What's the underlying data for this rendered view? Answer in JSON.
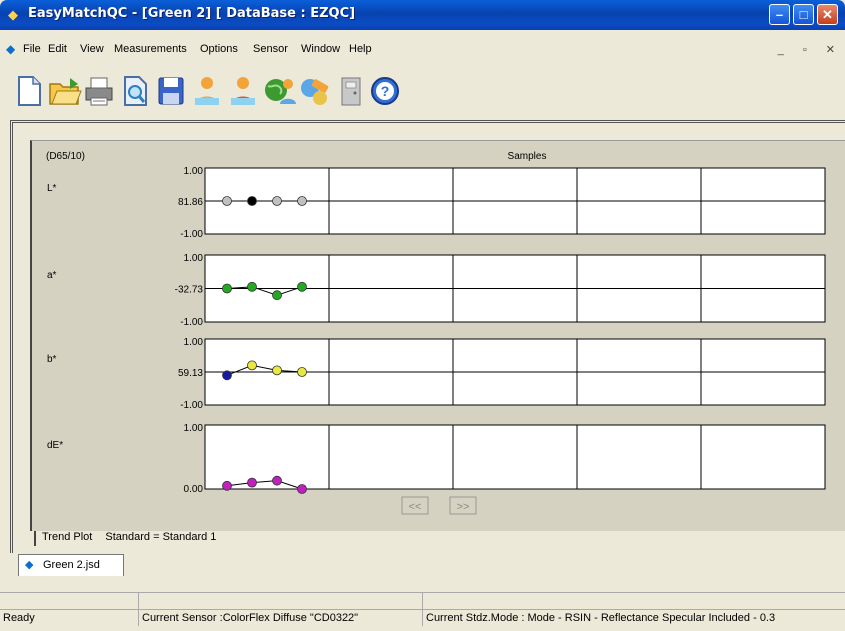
{
  "window": {
    "title": "EasyMatchQC - [Green 2]   [ DataBase : EZQC]"
  },
  "menu": {
    "items": [
      "File",
      "Edit",
      "View",
      "Measurements",
      "Options",
      "Sensor",
      "Window",
      "Help"
    ]
  },
  "toolbar": {
    "icons": [
      "new-document-icon",
      "open-folder-icon",
      "print-icon",
      "print-preview-icon",
      "save-icon",
      "standard-icon",
      "sample-icon",
      "database-icon",
      "sensor-icon",
      "exit-icon",
      "help-icon"
    ]
  },
  "plot": {
    "illuminant": "(D65/10)",
    "header": "Samples",
    "prev_label": "<<",
    "next_label": ">>",
    "charts": [
      {
        "label": "L*",
        "top_tick": "1.00",
        "mid_tick": "81.86",
        "bottom_tick": "-1.00"
      },
      {
        "label": "a*",
        "top_tick": "1.00",
        "mid_tick": "-32.73",
        "bottom_tick": "-1.00"
      },
      {
        "label": "b*",
        "top_tick": "1.00",
        "mid_tick": "59.13",
        "bottom_tick": "-1.00"
      },
      {
        "label": "dE*",
        "top_tick": "1.00",
        "bottom_tick": "0.00"
      }
    ]
  },
  "chart_data": [
    {
      "type": "line",
      "title": "L*",
      "x": [
        1,
        2,
        3,
        4
      ],
      "values": [
        0,
        0,
        0,
        0
      ],
      "ylim": [
        -1,
        1
      ],
      "point_colors": [
        "#c0c0c0",
        "#000000",
        "#c0c0c0",
        "#c0c0c0"
      ]
    },
    {
      "type": "line",
      "title": "a*",
      "x": [
        1,
        2,
        3,
        4
      ],
      "values": [
        0,
        0.05,
        -0.2,
        0.05
      ],
      "ylim": [
        -1,
        1
      ],
      "point_colors": [
        "#22aa22",
        "#22aa22",
        "#22aa22",
        "#22aa22"
      ]
    },
    {
      "type": "line",
      "title": "b*",
      "x": [
        1,
        2,
        3,
        4
      ],
      "values": [
        -0.1,
        0.2,
        0.05,
        0
      ],
      "ylim": [
        -1,
        1
      ],
      "point_colors": [
        "#1a1aa0",
        "#e8e840",
        "#e8e840",
        "#e8e840"
      ]
    },
    {
      "type": "line",
      "title": "dE*",
      "x": [
        1,
        2,
        3,
        4
      ],
      "values": [
        0.05,
        0.1,
        0.13,
        0.0
      ],
      "ylim": [
        0,
        1
      ],
      "point_colors": [
        "#c020c0",
        "#c020c0",
        "#c020c0",
        "#c020c0"
      ]
    }
  ],
  "footer": {
    "trend_label": "Trend Plot",
    "standard_text": "Standard = Standard 1"
  },
  "tab": {
    "label": "Green 2.jsd"
  },
  "status": {
    "ready": "Ready",
    "sensor": "Current Sensor :ColorFlex Diffuse \"CD0322\"",
    "mode": "Current Stdz.Mode : Mode - RSIN - Reflectance Specular Included - 0.3"
  }
}
